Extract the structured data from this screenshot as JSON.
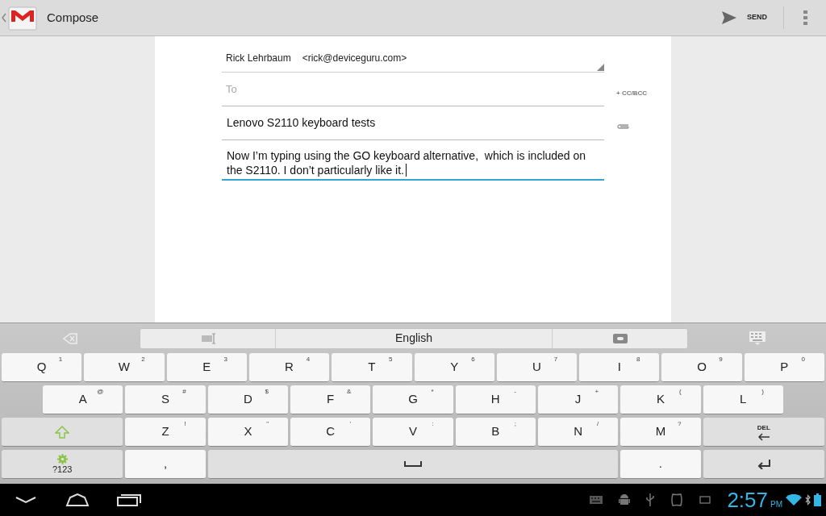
{
  "action_bar": {
    "title": "Compose",
    "send_label": "SEND"
  },
  "compose": {
    "from": {
      "name": "Rick Lehrbaum",
      "email": "<rick@deviceguru.com>"
    },
    "to": {
      "placeholder": "To"
    },
    "cc_bcc": "+ CC/BCC",
    "subject": "Lenovo S2110 keyboard tests",
    "body": {
      "value": "Now I’m typing using the GO keyboard alternative,  which is included on the S2110. I don’t particularly like it.",
      "focused": true
    }
  },
  "keyboard": {
    "language": "English",
    "rows": [
      {
        "keys": [
          {
            "kind": "letter",
            "label": "Q",
            "hint": "1"
          },
          {
            "kind": "letter",
            "label": "W",
            "hint": "2"
          },
          {
            "kind": "letter",
            "label": "E",
            "hint": "3"
          },
          {
            "kind": "letter",
            "label": "R",
            "hint": "4"
          },
          {
            "kind": "letter",
            "label": "T",
            "hint": "5"
          },
          {
            "kind": "letter",
            "label": "Y",
            "hint": "6"
          },
          {
            "kind": "letter",
            "label": "U",
            "hint": "7"
          },
          {
            "kind": "letter",
            "label": "I",
            "hint": "8"
          },
          {
            "kind": "letter",
            "label": "O",
            "hint": "9"
          },
          {
            "kind": "letter",
            "label": "P",
            "hint": "0"
          }
        ]
      },
      {
        "offset": true,
        "keys": [
          {
            "kind": "letter",
            "label": "A",
            "hint": "@"
          },
          {
            "kind": "letter",
            "label": "S",
            "hint": "#"
          },
          {
            "kind": "letter",
            "label": "D",
            "hint": "$"
          },
          {
            "kind": "letter",
            "label": "F",
            "hint": "&"
          },
          {
            "kind": "letter",
            "label": "G",
            "hint": "*"
          },
          {
            "kind": "letter",
            "label": "H",
            "hint": "-"
          },
          {
            "kind": "letter",
            "label": "J",
            "hint": "+"
          },
          {
            "kind": "letter",
            "label": "K",
            "hint": "("
          },
          {
            "kind": "letter",
            "label": "L",
            "hint": ")"
          }
        ]
      },
      {
        "keys": [
          {
            "kind": "shift"
          },
          {
            "kind": "letter",
            "label": "Z",
            "hint": "!"
          },
          {
            "kind": "letter",
            "label": "X",
            "hint": "\""
          },
          {
            "kind": "letter",
            "label": "C",
            "hint": "'"
          },
          {
            "kind": "letter",
            "label": "V",
            "hint": ":"
          },
          {
            "kind": "letter",
            "label": "B",
            "hint": ";"
          },
          {
            "kind": "letter",
            "label": "N",
            "hint": "/"
          },
          {
            "kind": "letter",
            "label": "M",
            "hint": "?"
          },
          {
            "kind": "delete",
            "label": "DEL"
          }
        ]
      },
      {
        "keys": [
          {
            "kind": "symbols",
            "label": "?123"
          },
          {
            "kind": "letter",
            "label": ","
          },
          {
            "kind": "space"
          },
          {
            "kind": "letter",
            "label": "."
          },
          {
            "kind": "enter"
          }
        ]
      }
    ]
  },
  "system_bar": {
    "time": "2:57",
    "meridiem": "PM"
  }
}
